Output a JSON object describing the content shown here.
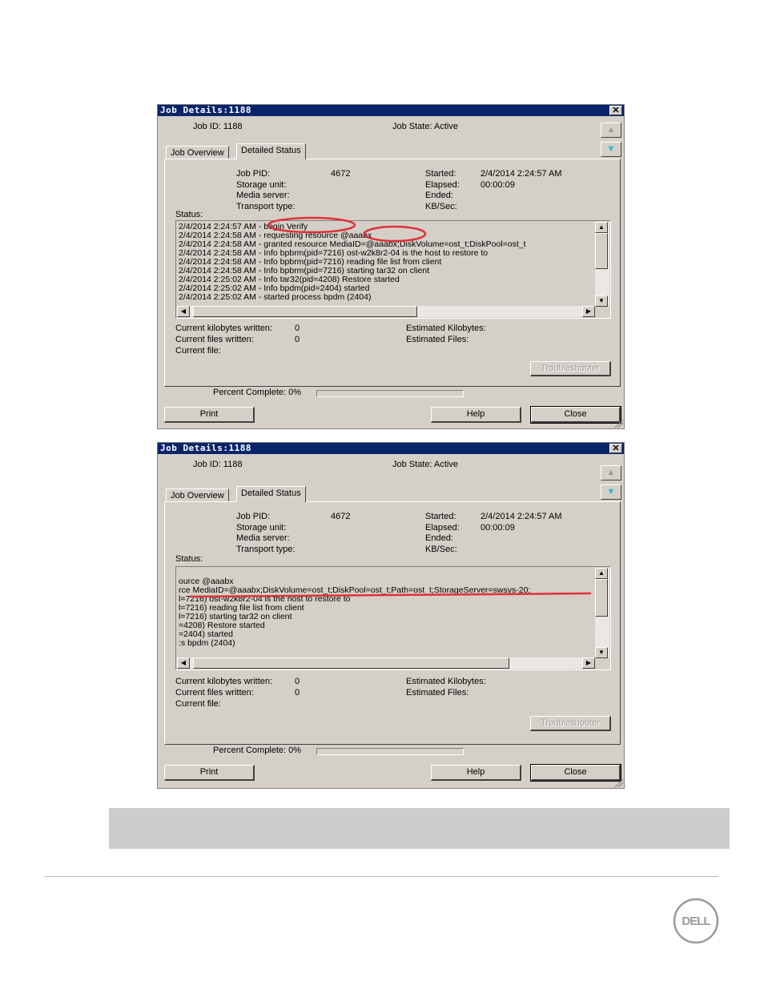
{
  "dialogs": [
    {
      "title": "Job Details:1188",
      "close_glyph": "✕",
      "job_id": "Job ID: 1188",
      "job_state": "Job State: Active",
      "tabs": [
        "Job Overview",
        "Detailed Status"
      ],
      "selected_tab": "Detailed Status",
      "info_left": [
        {
          "label": "Job PID:",
          "value": "4672"
        },
        {
          "label": "Storage unit:",
          "value": ""
        },
        {
          "label": "Media server:",
          "value": ""
        },
        {
          "label": "Transport type:",
          "value": ""
        }
      ],
      "info_right": [
        {
          "label": "Started:",
          "value": "2/4/2014 2:24:57 AM"
        },
        {
          "label": "Elapsed:",
          "value": "00:00:09"
        },
        {
          "label": "Ended:",
          "value": ""
        },
        {
          "label": "KB/Sec:",
          "value": ""
        }
      ],
      "status_label": "Status:",
      "log_lines": [
        "2/4/2014 2:24:57 AM - begin Verify",
        "2/4/2014 2:24:58 AM - requesting resource @aaabx",
        "2/4/2014 2:24:58 AM - granted resource MediaID=@aaabx;DiskVolume=ost_t;DiskPool=ost_t",
        "2/4/2014 2:24:58 AM - Info bpbrm(pid=7216) ost-w2k8r2-04 is the host to restore to",
        "2/4/2014 2:24:58 AM - Info bpbrm(pid=7216) reading file list from client",
        "2/4/2014 2:24:58 AM - Info bpbrm(pid=7216) starting tar32 on client",
        "2/4/2014 2:25:02 AM - Info tar32(pid=4208) Restore started",
        "2/4/2014 2:25:02 AM - Info bpdm(pid=2404) started",
        "2/4/2014 2:25:02 AM - started process bpdm (2404)"
      ],
      "progress_left": [
        {
          "label": "Current kilobytes written:",
          "value": "0"
        },
        {
          "label": "Current files written:",
          "value": "0"
        },
        {
          "label": "Current file:",
          "value": ""
        }
      ],
      "progress_right": [
        {
          "label": "Estimated Kilobytes:",
          "value": ""
        },
        {
          "label": "Estimated Files:",
          "value": ""
        }
      ],
      "troubleshooter_label": "Troubleshooter",
      "percent_label": "Percent Complete: 0%",
      "percent_complete": 0,
      "print_label": "Print",
      "help_label": "Help",
      "close_label": "Close",
      "annotation": "red-ellipses"
    },
    {
      "title": "Job Details:1188",
      "close_glyph": "✕",
      "job_id": "Job ID: 1188",
      "job_state": "Job State: Active",
      "tabs": [
        "Job Overview",
        "Detailed Status"
      ],
      "selected_tab": "Detailed Status",
      "info_left": [
        {
          "label": "Job PID:",
          "value": "4672"
        },
        {
          "label": "Storage unit:",
          "value": ""
        },
        {
          "label": "Media server:",
          "value": ""
        },
        {
          "label": "Transport type:",
          "value": ""
        }
      ],
      "info_right": [
        {
          "label": "Started:",
          "value": "2/4/2014 2:24:57 AM"
        },
        {
          "label": "Elapsed:",
          "value": "00:00:09"
        },
        {
          "label": "Ended:",
          "value": ""
        },
        {
          "label": "KB/Sec:",
          "value": ""
        }
      ],
      "status_label": "Status:",
      "log_lines": [
        "",
        "ource @aaabx",
        "rce MediaID=@aaabx;DiskVolume=ost_t;DiskPool=ost_t;Path=ost_t;StorageServer=swsys-20;",
        "l=7216) ost-w2k8r2-04 is the host to restore to",
        "l=7216) reading file list from client",
        "l=7216) starting tar32 on client",
        "=4208) Restore started",
        "=2404) started",
        ":s bpdm (2404)"
      ],
      "progress_left": [
        {
          "label": "Current kilobytes written:",
          "value": "0"
        },
        {
          "label": "Current files written:",
          "value": "0"
        },
        {
          "label": "Current file:",
          "value": ""
        }
      ],
      "progress_right": [
        {
          "label": "Estimated Kilobytes:",
          "value": ""
        },
        {
          "label": "Estimated Files:",
          "value": ""
        }
      ],
      "troubleshooter_label": "Troubleshooter",
      "percent_label": "Percent Complete: 0%",
      "percent_complete": 0,
      "print_label": "Print",
      "help_label": "Help",
      "close_label": "Close",
      "annotation": "red-underline"
    }
  ],
  "annotation_color": "#e0303a",
  "title_bar_color": "#0a246a",
  "logo": {
    "text": "DELL",
    "color": "#9a9a9a"
  }
}
